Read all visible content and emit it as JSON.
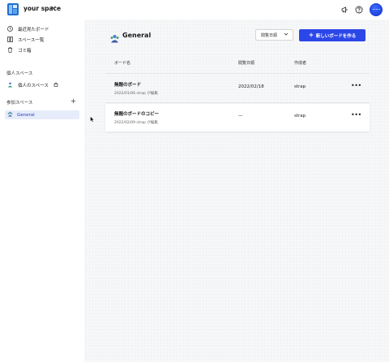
{
  "header": {
    "space_name": "your space",
    "icons": [
      "announcement-icon",
      "help-icon"
    ]
  },
  "sidebar": {
    "nav": [
      {
        "label": "最近見たボード",
        "icon": "clock-icon"
      },
      {
        "label": "スペース一覧",
        "icon": "columns-icon"
      },
      {
        "label": "ゴミ箱",
        "icon": "trash-icon"
      }
    ],
    "personal_section_title": "個人スペース",
    "personal_space_label": "個人のスペース",
    "joined_section_title": "参加スペース",
    "joined_spaces": [
      {
        "label": "General"
      }
    ]
  },
  "main": {
    "title": "General",
    "sort_label": "閲覧日順",
    "create_button_label": "新しいボードを作る",
    "columns": {
      "name": "ボード名",
      "viewed": "閲覧日順",
      "author": "作成者"
    },
    "rows": [
      {
        "title": "無題のボード",
        "sub": "2022/01/06 strap が編集",
        "viewed": "2022/02/18",
        "author": "strap"
      },
      {
        "title": "無題のボードのコピー",
        "sub": "2022/02/09 strap が編集",
        "viewed": "—",
        "author": "strap"
      }
    ]
  },
  "colors": {
    "accent": "#2c47e8",
    "selected_bg": "#e7ecfb"
  }
}
